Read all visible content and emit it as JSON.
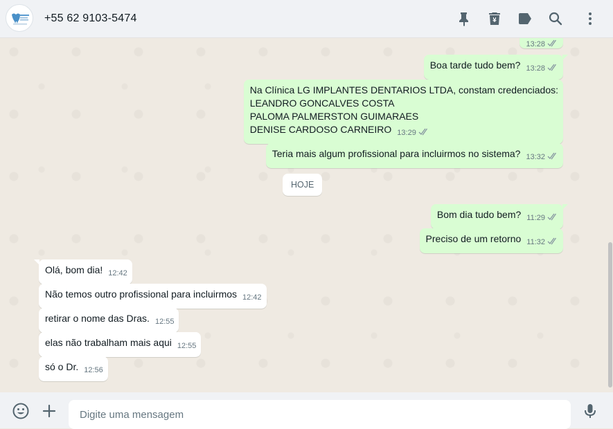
{
  "header": {
    "contact_name": "+55 62 9103-5474",
    "icons": [
      "pin-icon",
      "delete-icon",
      "label-icon",
      "search-icon",
      "menu-icon"
    ]
  },
  "chat": {
    "date_divider": "HOJE",
    "messages": [
      {
        "dir": "out",
        "text": "",
        "time": "13:28",
        "ticks": true
      },
      {
        "dir": "out",
        "text": "Boa tarde tudo bem?",
        "time": "13:28",
        "ticks": true
      },
      {
        "dir": "out",
        "text": "Na Clínica LG IMPLANTES DENTARIOS LTDA, constam credenciados:\nLEANDRO GONCALVES COSTA\nPALOMA PALMERSTON GUIMARAES\nDENISE CARDOSO CARNEIRO",
        "time": "13:29",
        "ticks": true
      },
      {
        "dir": "out",
        "text": "Teria mais algum profissional para incluirmos no sistema?",
        "time": "13:32",
        "ticks": true
      },
      {
        "dir": "out",
        "text": "Bom dia tudo bem?",
        "time": "11:29",
        "ticks": true
      },
      {
        "dir": "out",
        "text": "Preciso de um retorno",
        "time": "11:32",
        "ticks": true
      },
      {
        "dir": "in",
        "text": "Olá, bom dia!",
        "time": "12:42"
      },
      {
        "dir": "in",
        "text": "Não temos outro profissional para incluirmos",
        "time": "12:42"
      },
      {
        "dir": "in",
        "text": "retirar o nome das Dras.",
        "time": "12:55"
      },
      {
        "dir": "in",
        "text": "elas não trabalham mais aqui",
        "time": "12:55"
      },
      {
        "dir": "in",
        "text": "só o Dr.",
        "time": "12:56"
      }
    ]
  },
  "footer": {
    "placeholder": "Digite uma mensagem",
    "icons": [
      "emoji-icon",
      "attach-icon",
      "microphone-icon"
    ]
  },
  "colors": {
    "outgoing_bubble": "#d9fdd3",
    "incoming_bubble": "#ffffff",
    "chat_background": "#efeae2",
    "panel": "#f0f2f5"
  }
}
